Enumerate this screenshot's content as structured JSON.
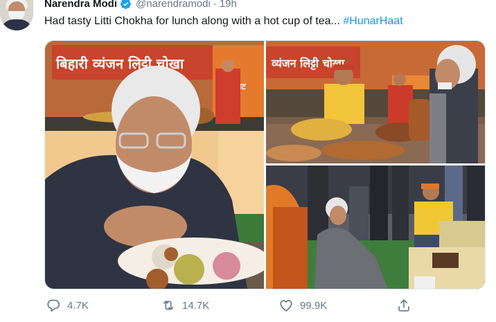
{
  "tweet": {
    "author_name": "Narendra Modi",
    "verified_icon": "verified-badge-icon",
    "handle": "@narendramodi",
    "separator": "·",
    "time": "19h",
    "text": "Had tasty Litti Chokha for lunch along with a hot cup of tea... ",
    "hashtag": "#HunarHaat",
    "media": {
      "photos": [
        {
          "sign_text": "बिहारी व्यंजन लिट्टी चोखा",
          "sign_extra": "हाट"
        },
        {
          "sign_text": "व्यंजन लिट्टी चोखा",
          "sign_extra": "हाट"
        },
        {
          "sign_text": ""
        }
      ]
    },
    "actions": {
      "reply": {
        "icon": "reply-icon",
        "count": "4.7K"
      },
      "retweet": {
        "icon": "retweet-icon",
        "count": "14.7K"
      },
      "like": {
        "icon": "heart-icon",
        "count": "99.9K"
      },
      "share": {
        "icon": "share-icon"
      }
    },
    "colors": {
      "hashtag": "#1b95e0",
      "verified": "#1da1f2",
      "muted": "#657786"
    }
  }
}
